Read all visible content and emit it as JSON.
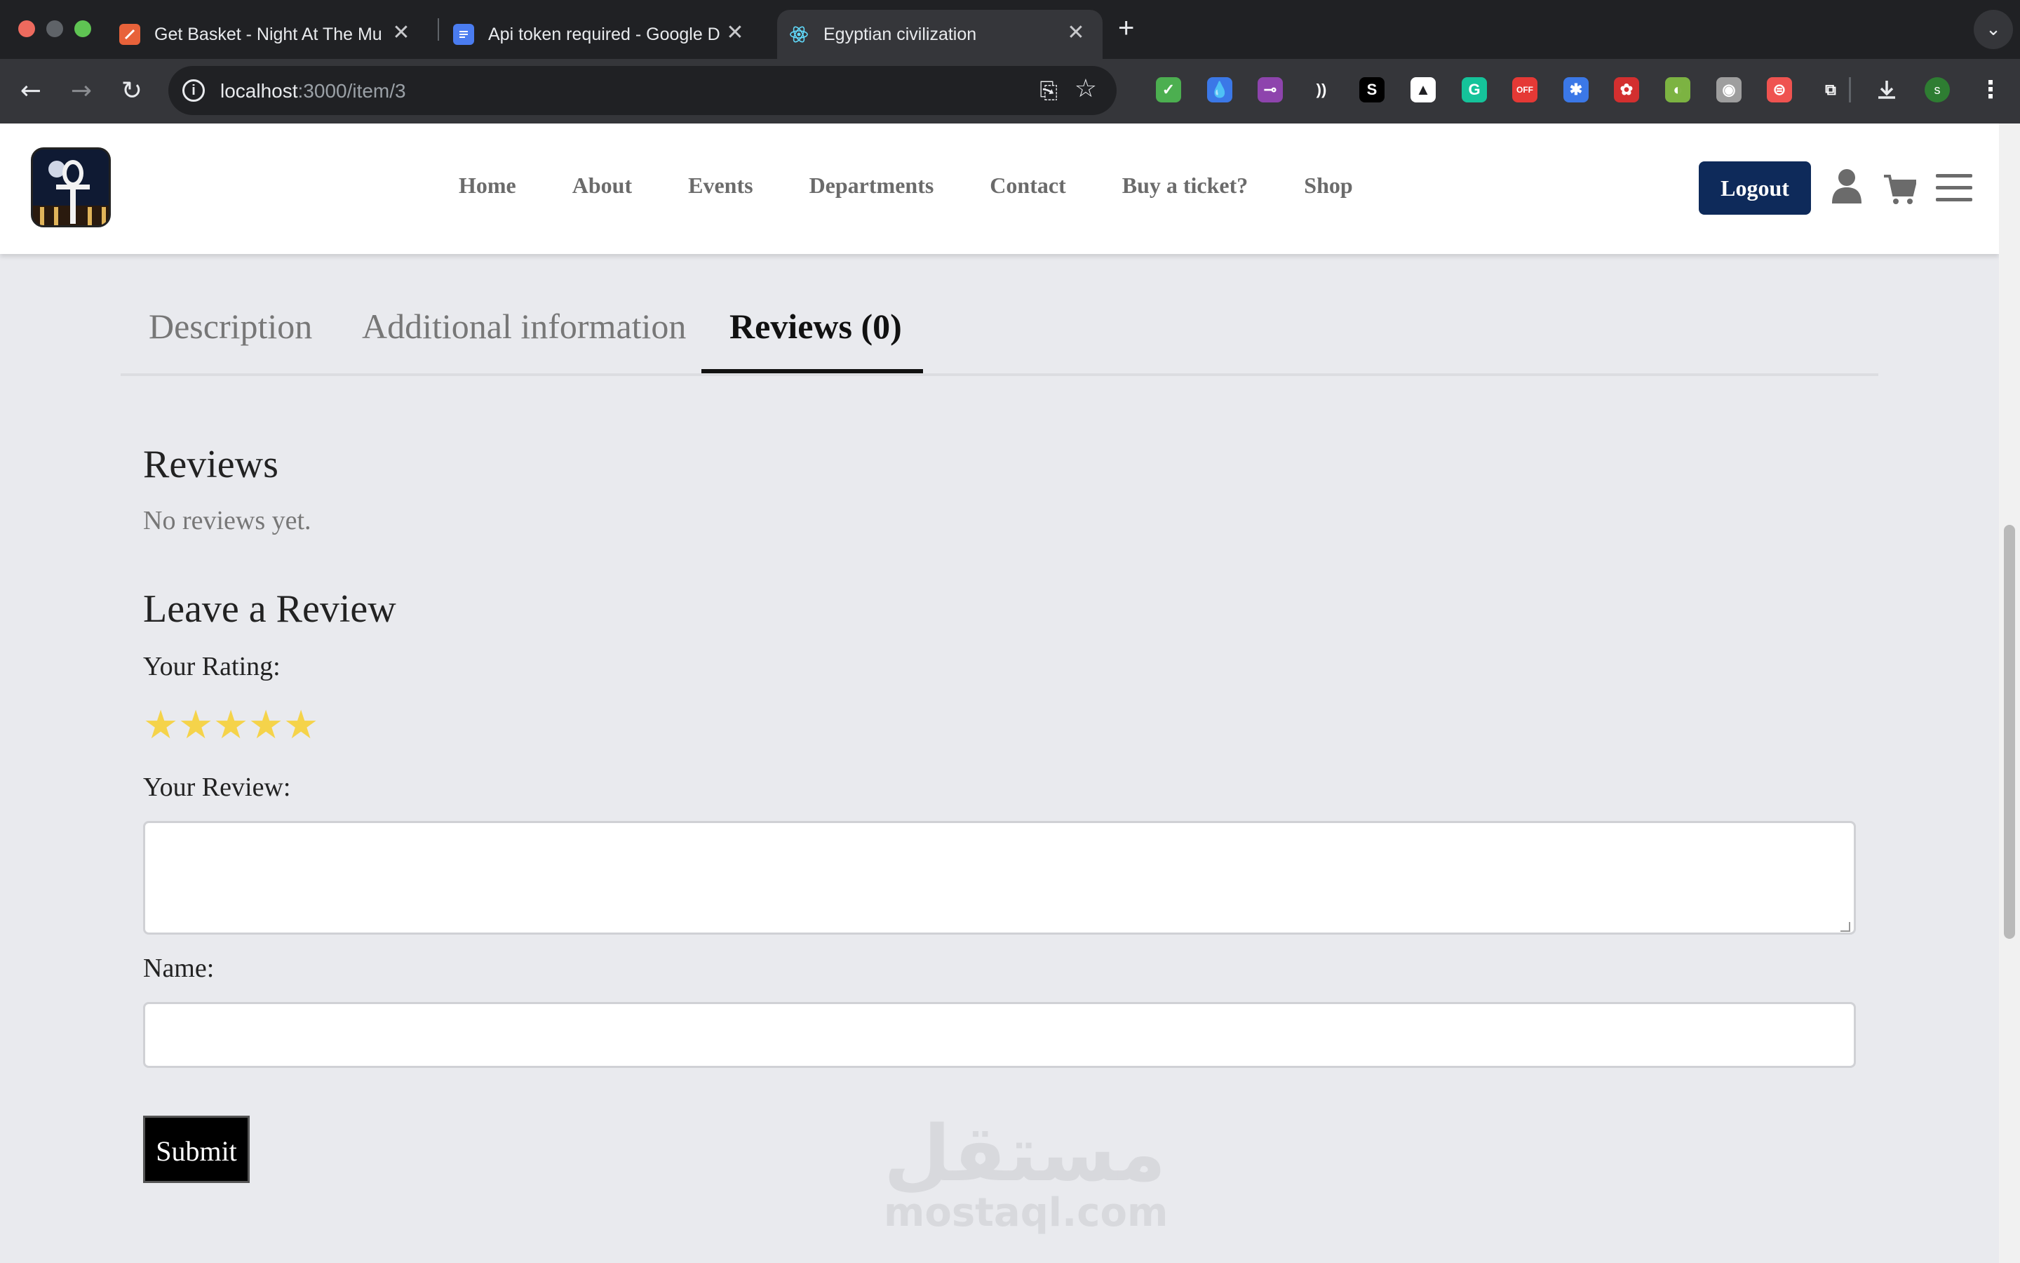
{
  "browser": {
    "tabs": [
      {
        "title": "Get Basket - Night At The Mu",
        "favicon_color": "#e8623a"
      },
      {
        "title": "Api token required - Google D",
        "favicon_color": "#4a7cf0"
      },
      {
        "title": "Egyptian civilization",
        "favicon_color": "#61dafb",
        "active": true
      }
    ],
    "close_glyph": "✕",
    "new_tab_glyph": "+",
    "tab_menu_glyph": "⌄",
    "url_host": "localhost",
    "url_path": ":3000/item/3",
    "avatar_letter": "s",
    "extensions": [
      {
        "name": "shield-extension-icon",
        "color": "#4caf50",
        "glyph": "✓"
      },
      {
        "name": "drop-extension-icon",
        "color": "#3b78e7",
        "glyph": "💧"
      },
      {
        "name": "commit-extension-icon",
        "color": "#8e44ad",
        "glyph": "⊸"
      },
      {
        "name": "wave-extension-icon",
        "color": "#35363a",
        "glyph": "))"
      },
      {
        "name": "s-extension-icon",
        "color": "#000000",
        "glyph": "S"
      },
      {
        "name": "arrow-extension-icon",
        "color": "#ffffff",
        "glyph": "▲"
      },
      {
        "name": "grammarly-extension-icon",
        "color": "#15c39a",
        "glyph": "G"
      },
      {
        "name": "off-extension-icon",
        "color": "#e53935",
        "glyph": "OFF"
      },
      {
        "name": "gear-extension-icon",
        "color": "#3b78e7",
        "glyph": "✱"
      },
      {
        "name": "bug-extension-icon",
        "color": "#d32f2f",
        "glyph": "✿"
      },
      {
        "name": "leaf-extension-icon",
        "color": "#7cb342",
        "glyph": "◐"
      },
      {
        "name": "camera-extension-icon",
        "color": "#9e9e9e",
        "glyph": "◉"
      },
      {
        "name": "translate-extension-icon",
        "color": "#ef5350",
        "glyph": "⊜"
      },
      {
        "name": "puzzle-extension-icon",
        "color": "#35363a",
        "glyph": "⧉"
      }
    ]
  },
  "site": {
    "nav": [
      "Home",
      "About",
      "Events",
      "Departments",
      "Contact",
      "Buy a ticket?",
      "Shop"
    ],
    "logout_label": "Logout",
    "brand_color": "#0e2a5a"
  },
  "product_tabs": {
    "description": "Description",
    "additional": "Additional information",
    "reviews": "Reviews (0)"
  },
  "reviews": {
    "heading": "Reviews",
    "empty_text": "No reviews yet.",
    "form_heading": "Leave a Review",
    "rating_label": "Your Rating:",
    "rating_stars": 5,
    "star_color": "#f5d34a",
    "review_label": "Your Review:",
    "review_value": "",
    "name_label": "Name:",
    "name_value": "",
    "submit_label": "Submit"
  },
  "watermark": {
    "arabic": "مستقل",
    "latin": "mostaql.com"
  }
}
